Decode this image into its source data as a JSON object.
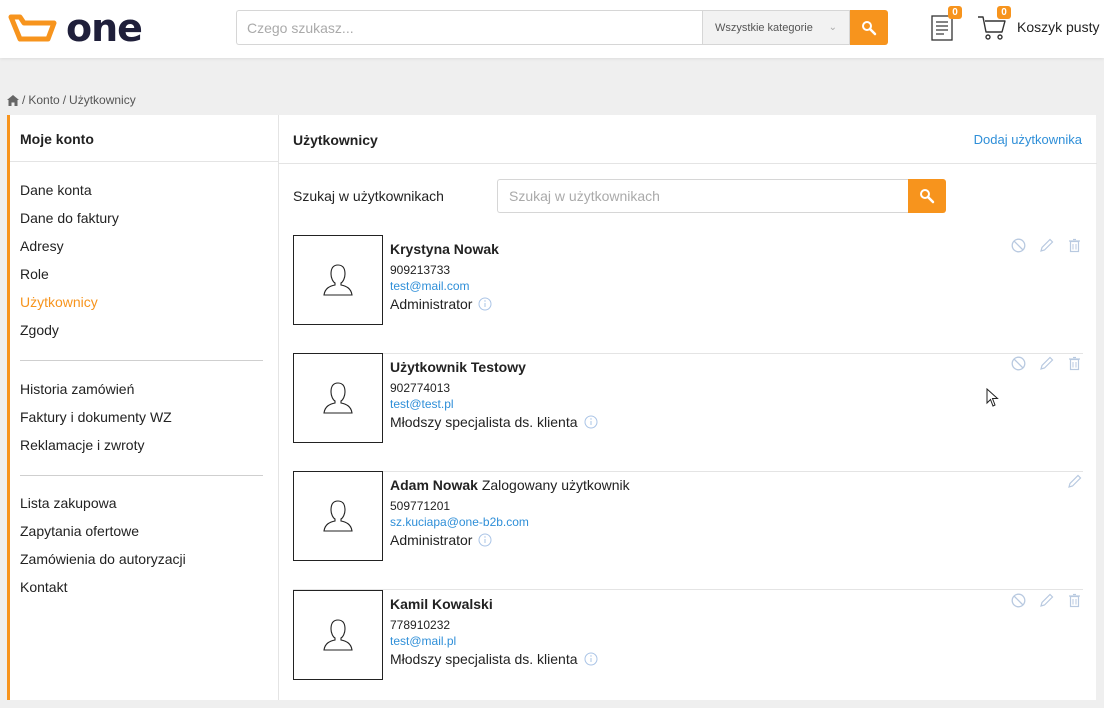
{
  "header": {
    "logo_text": "one",
    "search_placeholder": "Czego szukasz...",
    "category_label": "Wszystkie kategorie",
    "docs_count": "0",
    "cart_count": "0",
    "cart_label": "Koszyk pusty",
    "accent_color": "#f7941d"
  },
  "breadcrumb": {
    "icon": "home-icon",
    "items": [
      "Konto",
      "Użytkownicy"
    ],
    "separator": "/"
  },
  "sidebar": {
    "title": "Moje konto",
    "groups": [
      [
        "Dane konta",
        "Dane do faktury",
        "Adresy",
        "Role",
        "Użytkownicy",
        "Zgody"
      ],
      [
        "Historia zamówień",
        "Faktury i dokumenty WZ",
        "Reklamacje i zwroty"
      ],
      [
        "Lista zakupowa",
        "Zapytania ofertowe",
        "Zamówienia do autoryzacji",
        "Kontakt"
      ]
    ],
    "active": "Użytkownicy"
  },
  "main": {
    "title": "Użytkownicy",
    "add_user_label": "Dodaj użytkownika",
    "search_label": "Szukaj w użytkownikach",
    "search_placeholder": "Szukaj w użytkownikach",
    "users": [
      {
        "name": "Krystyna Nowak",
        "suffix": "",
        "phone": "909213733",
        "email": "test@mail.com",
        "role": "Administrator",
        "actions": [
          "block-icon",
          "edit-icon",
          "trash-icon"
        ]
      },
      {
        "name": "Użytkownik Testowy",
        "suffix": "",
        "phone": "902774013",
        "email": "test@test.pl",
        "role": "Młodszy specjalista ds. klienta",
        "actions": [
          "block-icon",
          "edit-icon",
          "trash-icon"
        ]
      },
      {
        "name": "Adam Nowak",
        "suffix": "Zalogowany użytkownik",
        "phone": "509771201",
        "email": "sz.kuciapa@one-b2b.com",
        "role": "Administrator",
        "actions": [
          "edit-icon"
        ]
      },
      {
        "name": "Kamil Kowalski",
        "suffix": "",
        "phone": "778910232",
        "email": "test@mail.pl",
        "role": "Młodszy specjalista ds. klienta",
        "actions": [
          "block-icon",
          "edit-icon",
          "trash-icon"
        ]
      }
    ]
  }
}
